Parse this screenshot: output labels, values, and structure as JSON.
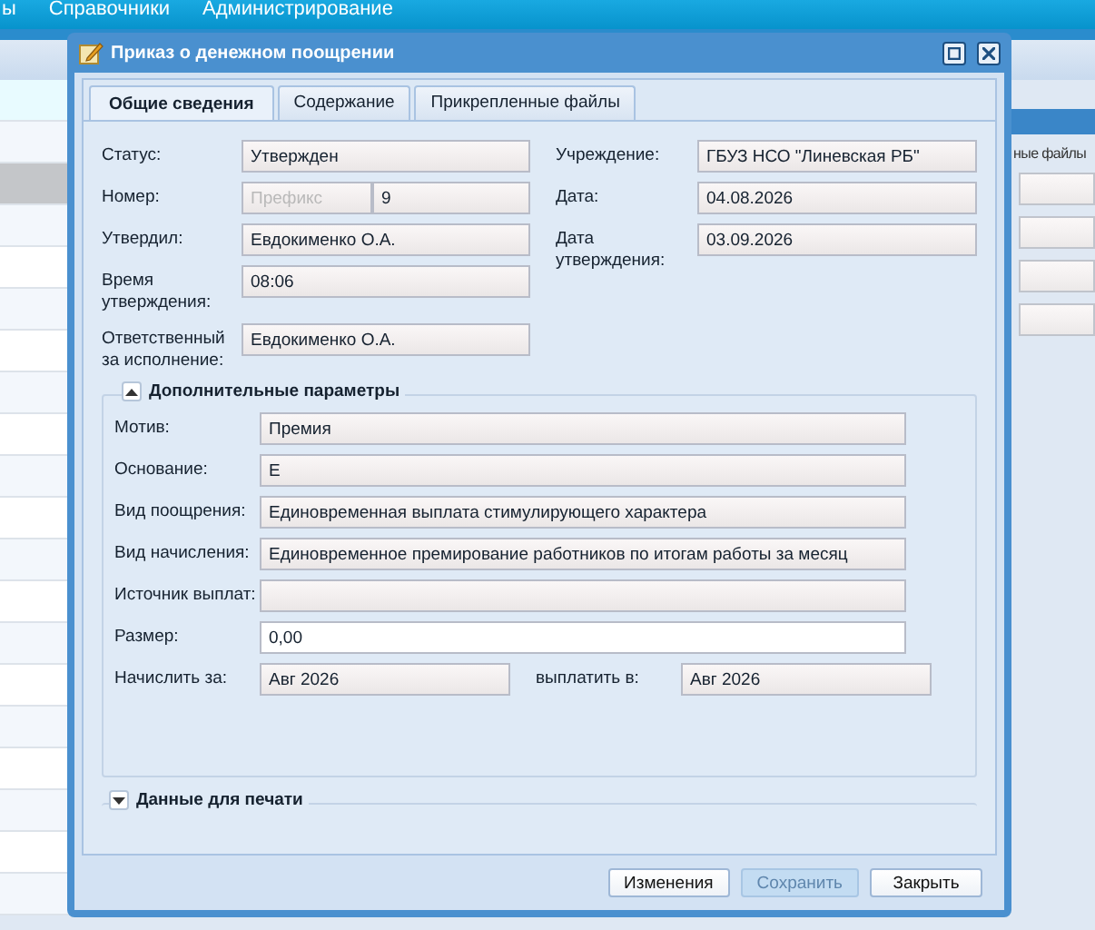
{
  "menu_bar": {
    "items": [
      "ы",
      "Справочники",
      "Администрирование"
    ]
  },
  "background_panel": {
    "tab_label": "ные файлы"
  },
  "dialog": {
    "title": "Приказ о денежном поощрении",
    "tabs": [
      {
        "label": "Общие сведения",
        "selected": true
      },
      {
        "label": "Содержание",
        "selected": false
      },
      {
        "label": "Прикрепленные файлы",
        "selected": false
      }
    ],
    "left_fields": [
      {
        "kind": "text",
        "label": "Статус:",
        "value": "Утвержден",
        "disabled": true
      },
      {
        "kind": "split",
        "label": "Номер:",
        "placeholder": "Префикс",
        "value": "9",
        "disabled": true
      },
      {
        "kind": "text",
        "label": "Утвердил:",
        "value": "Евдокименко О.А.",
        "disabled": true
      },
      {
        "kind": "text",
        "label": "Время утверждения:",
        "value": "08:06",
        "disabled": true
      },
      {
        "kind": "text",
        "label": "Ответственный за исполнение:",
        "value": "Евдокименко О.А.",
        "disabled": true
      }
    ],
    "right_fields": [
      {
        "kind": "text",
        "label": "Учреждение:",
        "value": "ГБУЗ НСО \"Линевская РБ\"",
        "disabled": true
      },
      {
        "kind": "text",
        "label": "Дата:",
        "value": "04.08.2026",
        "disabled": true
      },
      {
        "kind": "text",
        "label": "Дата утверждения:",
        "value": "03.09.2026",
        "disabled": true
      }
    ],
    "sections": [
      {
        "title": "Дополнительные параметры",
        "expanded": true,
        "fields": [
          {
            "kind": "text",
            "label": "Мотив:",
            "value": "Премия",
            "disabled": true
          },
          {
            "kind": "text",
            "label": "Основание:",
            "value": "Е",
            "disabled": true
          },
          {
            "kind": "text",
            "label": "Вид поощрения:",
            "value": "Единовременная выплата стимулирующего характера",
            "disabled": true
          },
          {
            "kind": "text",
            "label": "Вид начисления:",
            "value": "Единовременное премирование работников по итогам работы за месяц",
            "disabled": true
          },
          {
            "kind": "text",
            "label": "Источник выплат:",
            "disabled": true
          },
          {
            "kind": "text",
            "label": "Размер:",
            "value": "0,00",
            "disabled": false
          },
          {
            "kind": "pair",
            "label": "Начислить за:",
            "value": "Авг 2026",
            "label2": "выплатить в:",
            "value2": "Авг 2026",
            "disabled": true
          }
        ]
      },
      {
        "title": "Данные для печати",
        "expanded": false
      }
    ],
    "buttons": [
      {
        "label": "Изменения",
        "disabled": false
      },
      {
        "label": "Сохранить",
        "disabled": true
      },
      {
        "label": "Закрыть",
        "disabled": false
      }
    ]
  }
}
